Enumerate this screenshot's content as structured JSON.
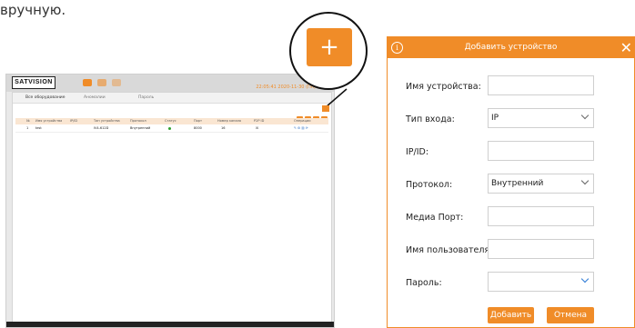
{
  "caption": "вручную.",
  "app": {
    "logo": "SATVISION",
    "clock": "22:05:41 2020-11-30 (Пн) 09:03",
    "tabs": [
      "Все оборудование",
      "Аномалии",
      "Пароль"
    ],
    "table_headers": [
      "№",
      "Имя устройства",
      "IP/ID",
      "Тип устройства",
      "Протокол",
      "Статус",
      "Порт",
      "Номер канала",
      "P2P ID",
      "Операции"
    ],
    "row": {
      "no": "1",
      "name": "test",
      "ip": "",
      "type": "IV4-612D",
      "protocol": "Внутренний",
      "port": "8000",
      "channels": "16",
      "p2p": "☒"
    }
  },
  "zoom": {
    "symbol": "+"
  },
  "dialog": {
    "title": "Добавить устройство",
    "fields": [
      {
        "label": "Имя устройства:",
        "value": "",
        "type": "text"
      },
      {
        "label": "Тип входа:",
        "value": "IP",
        "type": "select"
      },
      {
        "label": "IP/ID:",
        "value": "",
        "type": "text"
      },
      {
        "label": "Протокол:",
        "value": "Внутренний",
        "type": "select"
      },
      {
        "label": "Медиа Порт:",
        "value": "",
        "type": "text"
      },
      {
        "label": "Имя пользователя:",
        "value": "",
        "type": "text"
      },
      {
        "label": "Пароль:",
        "value": "",
        "type": "select"
      }
    ],
    "add_label": "Добавить",
    "cancel_label": "Отмена"
  },
  "colors": {
    "accent": "#f08c28",
    "chevron_blue": "#2e7bd6"
  }
}
